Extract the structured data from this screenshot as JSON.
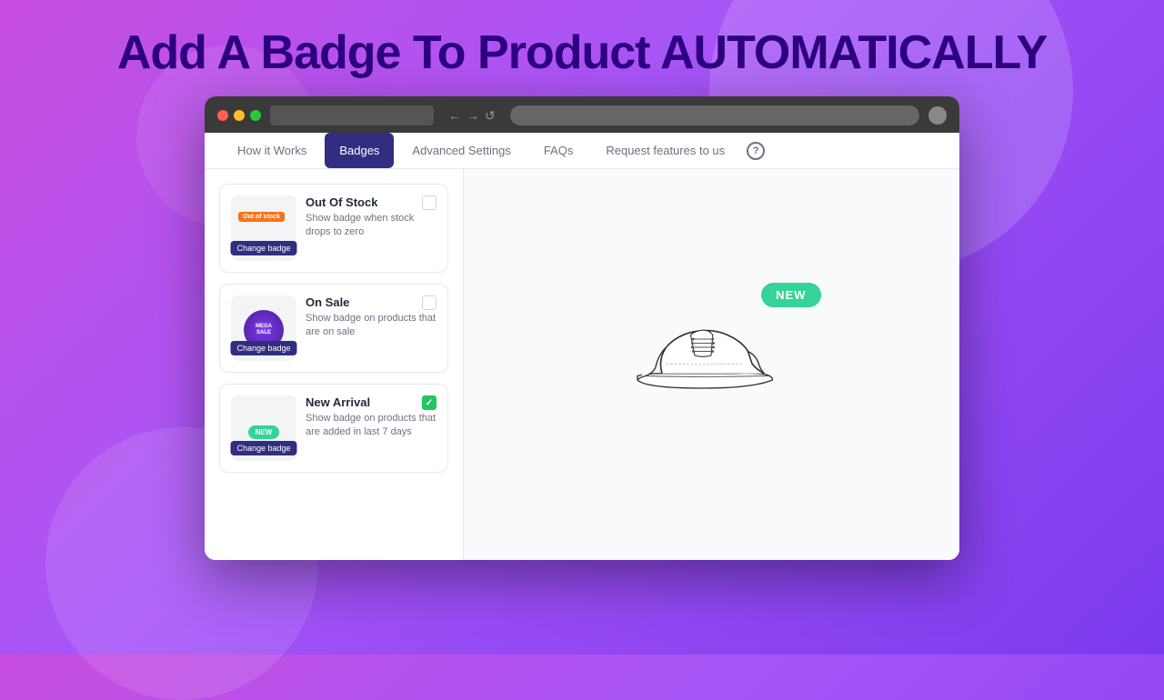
{
  "page": {
    "heading_white": "Add A Badge To Product ",
    "heading_purple": "AUTOMATICALLY"
  },
  "browser": {
    "address": "",
    "back": "←",
    "forward": "→",
    "refresh": "↺"
  },
  "nav": {
    "tabs": [
      {
        "id": "how-it-works",
        "label": "How it Works",
        "active": false
      },
      {
        "id": "badges",
        "label": "Badges",
        "active": true
      },
      {
        "id": "advanced-settings",
        "label": "Advanced Settings",
        "active": false
      },
      {
        "id": "faqs",
        "label": "FAQs",
        "active": false
      },
      {
        "id": "request-features",
        "label": "Request features to us",
        "active": false
      }
    ],
    "help_label": "?"
  },
  "badges": [
    {
      "id": "out-of-stock",
      "name": "Out Of Stock",
      "description": "Show badge when stock drops to zero",
      "badge_text": "Out of stock",
      "badge_type": "out-of-stock",
      "change_label": "Change badge",
      "checked": false
    },
    {
      "id": "on-sale",
      "name": "On Sale",
      "description": "Show badge on products that are on sale",
      "badge_text": "MEGA SALE",
      "badge_type": "mega-sale",
      "change_label": "Change badge",
      "checked": false
    },
    {
      "id": "new-arrival",
      "name": "New Arrival",
      "description": "Show badge on products that are added in last 7 days",
      "badge_text": "NEW",
      "badge_type": "new",
      "change_label": "Change badge",
      "checked": true
    }
  ],
  "preview": {
    "new_badge": "NEW"
  }
}
